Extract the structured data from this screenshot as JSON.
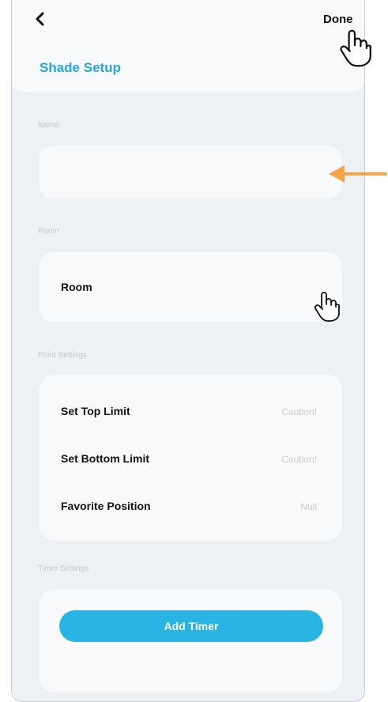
{
  "header": {
    "done_label": "Done",
    "title": "Shade Setup"
  },
  "name_section": {
    "label": "Name",
    "value": "",
    "placeholder": ""
  },
  "room_section": {
    "label": "Room",
    "row_label": "Room"
  },
  "point_settings": {
    "label": "Point Settings",
    "rows": [
      {
        "label": "Set Top Limit",
        "value": "Caution!"
      },
      {
        "label": "Set Bottom Limit",
        "value": "Caution!"
      },
      {
        "label": "Favorite Position",
        "value": "Null"
      }
    ]
  },
  "timer_settings": {
    "label": "Timer Settings",
    "button_label": "Add Timer"
  },
  "colors": {
    "accent": "#29b4e3",
    "title": "#25a8d8",
    "annotation_arrow": "#f4a44a"
  },
  "icons": [
    "back-icon",
    "hand-pointer-icon",
    "arrow-left-icon"
  ]
}
